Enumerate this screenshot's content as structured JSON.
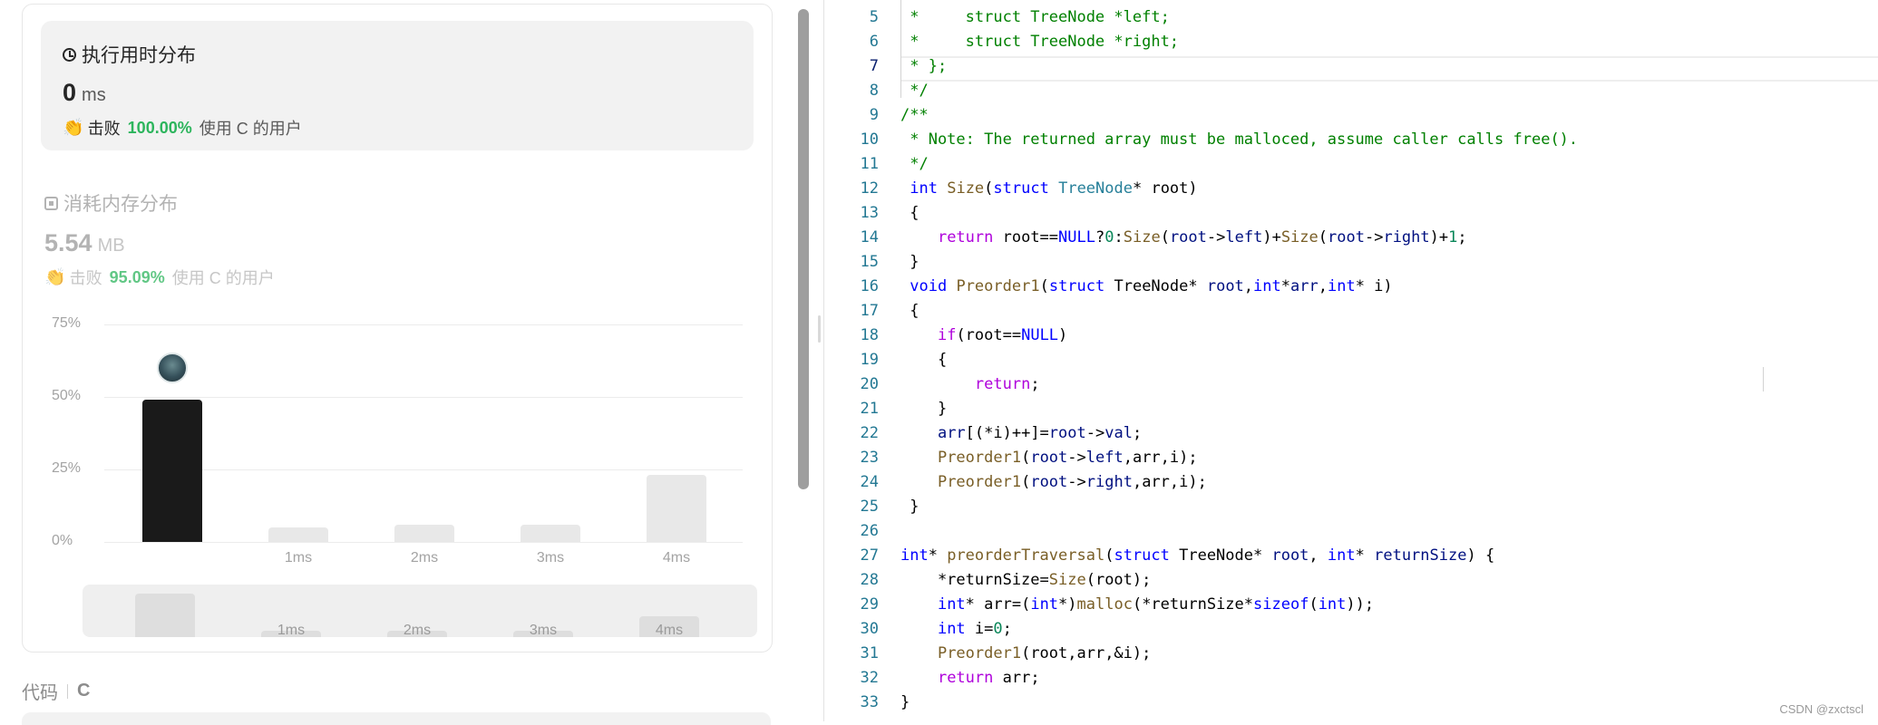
{
  "stats": {
    "runtime": {
      "title": "执行用时分布",
      "value": "0",
      "unit": "ms",
      "beat_label": "击败",
      "beat_pct": "100.00%",
      "beat_suffix": "使用 C 的用户"
    },
    "memory": {
      "title": "消耗内存分布",
      "value": "5.54",
      "unit": "MB",
      "beat_label": "击败",
      "beat_pct": "95.09%",
      "beat_suffix": "使用 C 的用户"
    },
    "colors": {
      "accent_green": "#2db55d",
      "bar_selected": "#1a1a1a",
      "bar_default": "#e8e8e8"
    }
  },
  "chart_data": {
    "type": "bar",
    "categories": [
      "0ms",
      "1ms",
      "2ms",
      "3ms",
      "4ms"
    ],
    "x_tick_labels": [
      "",
      "1ms",
      "2ms",
      "3ms",
      "4ms"
    ],
    "values": [
      49,
      5,
      6,
      6,
      23
    ],
    "selected_index": 0,
    "y_ticks": [
      "0%",
      "25%",
      "50%",
      "75%"
    ],
    "ylim": [
      0,
      75
    ],
    "grid": true,
    "unit": "%"
  },
  "code_section": {
    "label": "代码",
    "language": "C"
  },
  "editor": {
    "current_line": 7,
    "lines": [
      {
        "n": "5",
        "code": [
          [
            "t-cm",
            " *     struct TreeNode *left;"
          ]
        ]
      },
      {
        "n": "6",
        "code": [
          [
            "t-cm",
            " *     struct TreeNode *right;"
          ]
        ]
      },
      {
        "n": "7",
        "code": [
          [
            "t-cm",
            " * };"
          ]
        ]
      },
      {
        "n": "8",
        "code": [
          [
            "t-cm",
            " */"
          ]
        ]
      },
      {
        "n": "9",
        "code": [
          [
            "t-cm",
            "/**"
          ]
        ]
      },
      {
        "n": "10",
        "code": [
          [
            "t-cm",
            " * Note: The returned array must be malloced, assume caller calls free()."
          ]
        ]
      },
      {
        "n": "11",
        "code": [
          [
            "t-cm",
            " */"
          ]
        ]
      },
      {
        "n": "12",
        "code": [
          [
            "",
            " "
          ],
          [
            "t-kw",
            "int"
          ],
          [
            "",
            " "
          ],
          [
            "t-fn",
            "Size"
          ],
          [
            "",
            "("
          ],
          [
            "t-kw",
            "struct"
          ],
          [
            "",
            " "
          ],
          [
            "t-ty",
            "TreeNode"
          ],
          [
            "",
            "* root)"
          ]
        ]
      },
      {
        "n": "13",
        "code": [
          [
            "",
            " {"
          ]
        ]
      },
      {
        "n": "14",
        "code": [
          [
            "",
            "    "
          ],
          [
            "t-ctl",
            "return"
          ],
          [
            "",
            " root=="
          ],
          [
            "t-kw",
            "NULL"
          ],
          [
            "",
            "?"
          ],
          [
            "t-nm",
            "0"
          ],
          [
            "",
            ":"
          ],
          [
            "t-fn",
            "Size"
          ],
          [
            "",
            "("
          ],
          [
            "t-var",
            "root"
          ],
          [
            "",
            "->"
          ],
          [
            "t-var",
            "left"
          ],
          [
            "",
            ")+"
          ],
          [
            "t-fn",
            "Size"
          ],
          [
            "",
            "("
          ],
          [
            "t-var",
            "root"
          ],
          [
            "",
            "->"
          ],
          [
            "t-var",
            "right"
          ],
          [
            "",
            ")+"
          ],
          [
            "t-nm",
            "1"
          ],
          [
            "",
            ";"
          ]
        ]
      },
      {
        "n": "15",
        "code": [
          [
            "",
            " }"
          ]
        ]
      },
      {
        "n": "16",
        "code": [
          [
            "",
            " "
          ],
          [
            "t-kw",
            "void"
          ],
          [
            "",
            " "
          ],
          [
            "t-fn",
            "Preorder1"
          ],
          [
            "",
            "("
          ],
          [
            "t-kw",
            "struct"
          ],
          [
            "",
            " TreeNode* "
          ],
          [
            "t-var",
            "root"
          ],
          [
            "",
            ","
          ],
          [
            "t-kw",
            "int"
          ],
          [
            "",
            "*"
          ],
          [
            "t-var",
            "arr"
          ],
          [
            "",
            ","
          ],
          [
            "t-kw",
            "int"
          ],
          [
            "",
            "* i)"
          ]
        ]
      },
      {
        "n": "17",
        "code": [
          [
            "",
            " {"
          ]
        ]
      },
      {
        "n": "18",
        "code": [
          [
            "",
            "    "
          ],
          [
            "t-ctl",
            "if"
          ],
          [
            "",
            "(root=="
          ],
          [
            "t-kw",
            "NULL"
          ],
          [
            "",
            ")"
          ]
        ]
      },
      {
        "n": "19",
        "code": [
          [
            "",
            "    {"
          ]
        ]
      },
      {
        "n": "20",
        "code": [
          [
            "",
            "        "
          ],
          [
            "t-ctl",
            "return"
          ],
          [
            "",
            ";"
          ]
        ]
      },
      {
        "n": "21",
        "code": [
          [
            "",
            "    }"
          ]
        ]
      },
      {
        "n": "22",
        "code": [
          [
            "",
            "    "
          ],
          [
            "t-var",
            "arr"
          ],
          [
            "",
            "[(*i)++]="
          ],
          [
            "t-var",
            "root"
          ],
          [
            "",
            "->"
          ],
          [
            "t-var",
            "val"
          ],
          [
            "",
            ";"
          ]
        ]
      },
      {
        "n": "23",
        "code": [
          [
            "",
            "    "
          ],
          [
            "t-fn",
            "Preorder1"
          ],
          [
            "",
            "("
          ],
          [
            "t-var",
            "root"
          ],
          [
            "",
            "->"
          ],
          [
            "t-var",
            "left"
          ],
          [
            "",
            ",arr,i);"
          ]
        ]
      },
      {
        "n": "24",
        "code": [
          [
            "",
            "    "
          ],
          [
            "t-fn",
            "Preorder1"
          ],
          [
            "",
            "("
          ],
          [
            "t-var",
            "root"
          ],
          [
            "",
            "->"
          ],
          [
            "t-var",
            "right"
          ],
          [
            "",
            ",arr,i);"
          ]
        ]
      },
      {
        "n": "25",
        "code": [
          [
            "",
            " }"
          ]
        ]
      },
      {
        "n": "26",
        "code": [
          [
            "",
            ""
          ]
        ]
      },
      {
        "n": "27",
        "code": [
          [
            "t-kw",
            "int"
          ],
          [
            "",
            "* "
          ],
          [
            "t-fn",
            "preorderTraversal"
          ],
          [
            "",
            "("
          ],
          [
            "t-kw",
            "struct"
          ],
          [
            "",
            " TreeNode* "
          ],
          [
            "t-var",
            "root"
          ],
          [
            "",
            ", "
          ],
          [
            "t-kw",
            "int"
          ],
          [
            "",
            "* "
          ],
          [
            "t-var",
            "returnSize"
          ],
          [
            "",
            ") {"
          ]
        ]
      },
      {
        "n": "28",
        "code": [
          [
            "",
            "    *returnSize="
          ],
          [
            "t-fn",
            "Size"
          ],
          [
            "",
            "(root);"
          ]
        ]
      },
      {
        "n": "29",
        "code": [
          [
            "",
            "    "
          ],
          [
            "t-kw",
            "int"
          ],
          [
            "",
            "* arr=("
          ],
          [
            "t-kw",
            "int"
          ],
          [
            "",
            "*)"
          ],
          [
            "t-fn",
            "malloc"
          ],
          [
            "",
            "(*returnSize*"
          ],
          [
            "t-kw",
            "sizeof"
          ],
          [
            "",
            "("
          ],
          [
            "t-kw",
            "int"
          ],
          [
            "",
            "));"
          ]
        ]
      },
      {
        "n": "30",
        "code": [
          [
            "",
            "    "
          ],
          [
            "t-kw",
            "int"
          ],
          [
            "",
            " i="
          ],
          [
            "t-nm",
            "0"
          ],
          [
            "",
            ";"
          ]
        ]
      },
      {
        "n": "31",
        "code": [
          [
            "",
            "    "
          ],
          [
            "t-fn",
            "Preorder1"
          ],
          [
            "",
            "(root,arr,&i);"
          ]
        ]
      },
      {
        "n": "32",
        "code": [
          [
            "",
            "    "
          ],
          [
            "t-ctl",
            "return"
          ],
          [
            "",
            " arr;"
          ]
        ]
      },
      {
        "n": "33",
        "code": [
          [
            "",
            "}"
          ]
        ]
      }
    ]
  },
  "watermark": "CSDN @zxctscl"
}
